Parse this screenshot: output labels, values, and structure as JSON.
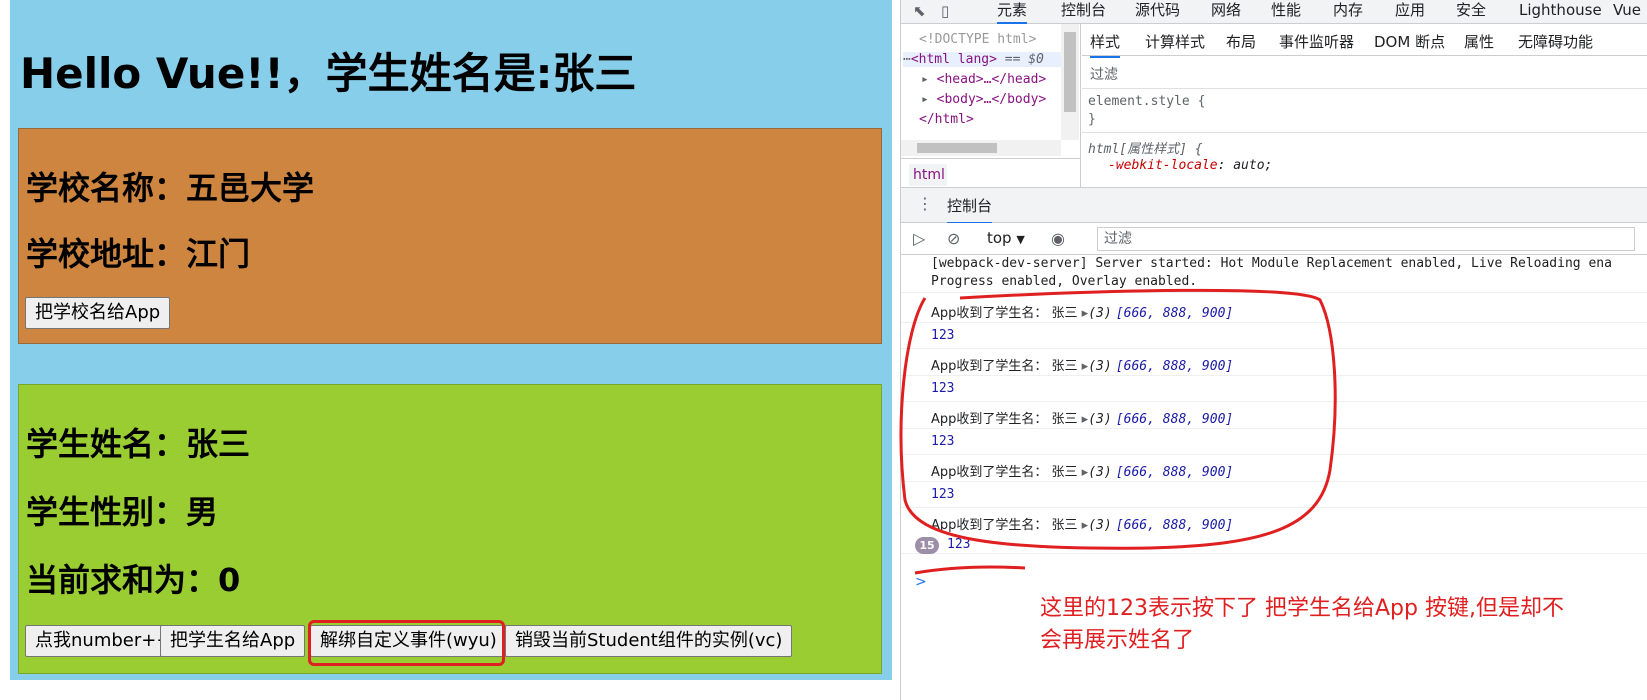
{
  "app": {
    "title": "Hello Vue!!，学生姓名是:张三",
    "school": {
      "name": "学校名称：五邑大学",
      "address": "学校地址：江门",
      "button": "把学校名给App"
    },
    "student": {
      "name": "学生姓名：张三",
      "gender": "学生性别：男",
      "sum": "当前求和为：0",
      "buttons": [
        "点我number++",
        "把学生名给App",
        "解绑自定义事件(wyu)",
        "销毁当前Student组件的实例(vc)"
      ]
    }
  },
  "devtools": {
    "top_tabs": [
      "元素",
      "控制台",
      "源代码",
      "网络",
      "性能",
      "内存",
      "应用",
      "安全",
      "Lighthouse",
      "Vue"
    ],
    "active_top_tab": "元素",
    "elements_tree": [
      "<!DOCTYPE html>",
      "<html lang>",
      "== $0",
      "<head>…</head>",
      "<body>…</body>",
      "</html>"
    ],
    "breadcrumb": "html",
    "styles_tabs": [
      "样式",
      "计算样式",
      "布局",
      "事件监听器",
      "DOM 断点",
      "属性",
      "无障碍功能"
    ],
    "styles_filter": "过滤",
    "styles_rules": {
      "element_style": "element.style {",
      "element_close": "}",
      "html_rule": "html[属性样式] {",
      "locale_prop": "-webkit-locale",
      "locale_val": "auto;"
    },
    "drawer_tab": "控制台",
    "console_context": "top",
    "console_filter": "过滤",
    "server_msg_1": "[webpack-dev-server] Server started: Hot Module Replacement enabled, Live Reloading ena",
    "server_msg_2": "Progress enabled, Overlay enabled.",
    "log_prefix": "App收到了学生名： 张三",
    "log_array_len": "(3)",
    "log_array_vals": "[666, 888, 900]",
    "log_number": "123",
    "repeat_count": "15",
    "prompt": ">"
  },
  "annotation": {
    "line1": "这里的123表示按下了 把学生名给App 按键,但是却不",
    "line2": "会再展示姓名了",
    "color": "#e02020"
  }
}
